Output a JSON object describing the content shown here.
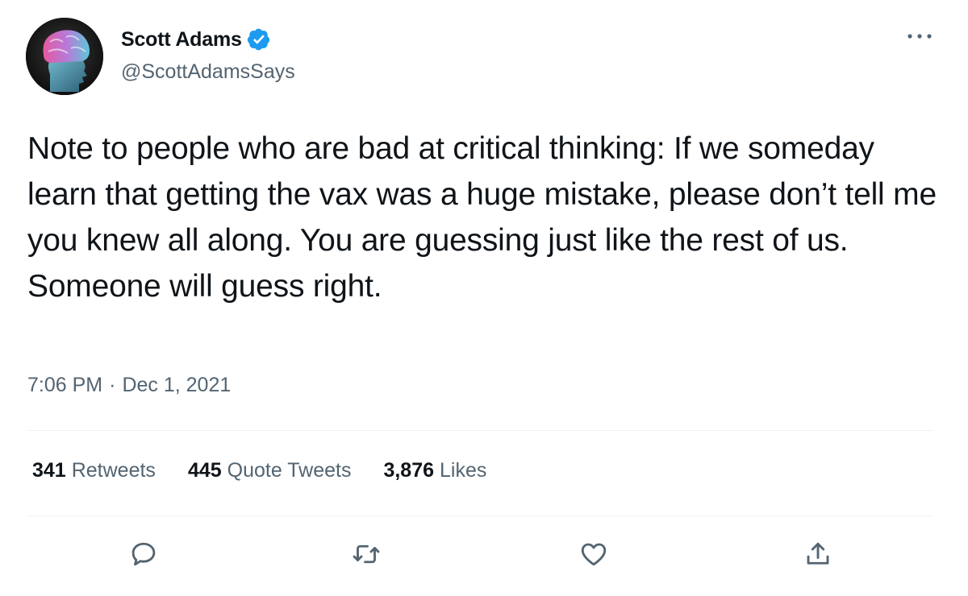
{
  "author": {
    "display_name": "Scott Adams",
    "handle": "@ScottAdamsSays",
    "verified": true,
    "avatar_icon": "brain-head-icon"
  },
  "tweet": {
    "text": "Note to people who are bad at critical thinking: If we someday learn that getting the vax was a huge mistake, please don’t tell me you knew all along. You are guessing just like the rest of us. Someone will guess right.",
    "time": "7:06 PM",
    "separator": "·",
    "date": "Dec 1, 2021"
  },
  "stats": {
    "retweets": {
      "count": "341",
      "label": "Retweets"
    },
    "quote_tweets": {
      "count": "445",
      "label": "Quote Tweets"
    },
    "likes": {
      "count": "3,876",
      "label": "Likes"
    }
  },
  "actions": {
    "reply_icon": "reply-icon",
    "retweet_icon": "retweet-icon",
    "like_icon": "heart-icon",
    "share_icon": "share-icon",
    "more_icon": "more-options-icon"
  },
  "colors": {
    "text_primary": "#0f1419",
    "text_secondary": "#536471",
    "verified_blue": "#1d9bf0",
    "divider": "#eff3f4"
  }
}
